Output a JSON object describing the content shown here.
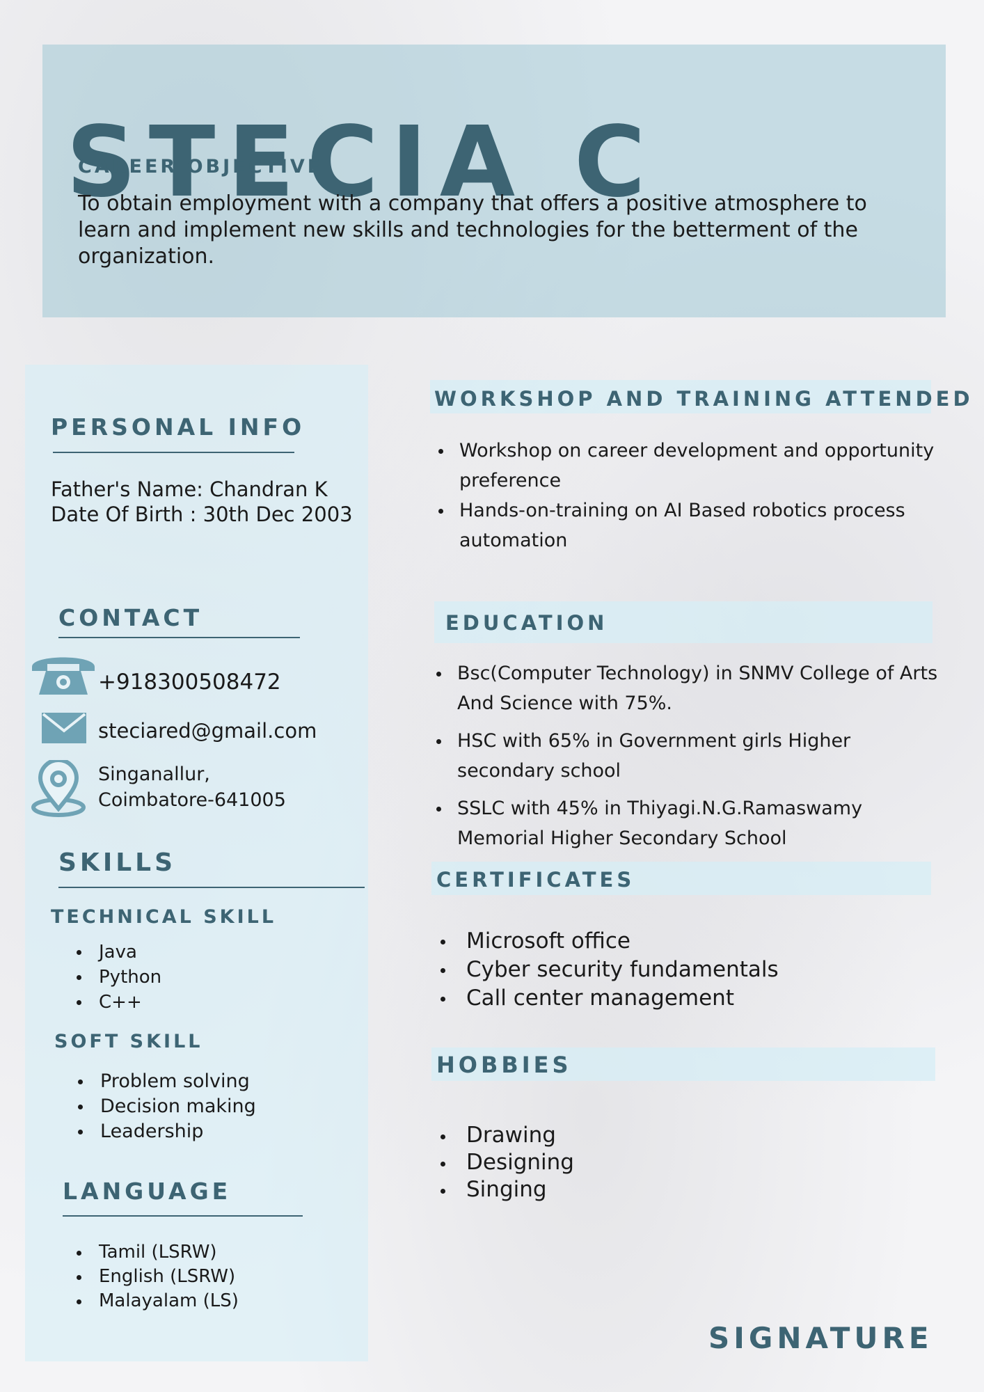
{
  "name": "STECIA C",
  "career_objective": {
    "heading": "CAREER OBJECTIVE",
    "lines": [
      "To obtain employment with a company that offers a positive atmosphere to",
      "learn and implement new skills and technologies for the betterment of the",
      "organization."
    ]
  },
  "personal_info": {
    "heading": "PERSONAL INFO",
    "fathers_name": "Father's Name: Chandran K",
    "dob": "Date Of Birth : 30th Dec 2003"
  },
  "contact": {
    "heading": "CONTACT",
    "phone": "+918300508472",
    "email": "steciared@gmail.com",
    "address_line1": "Singanallur,",
    "address_line2": "Coimbatore-641005",
    "icons": [
      "phone-icon",
      "email-icon",
      "location-pin-icon"
    ]
  },
  "skills": {
    "heading": "SKILLS",
    "technical_heading": "TECHNICAL SKILL",
    "technical": [
      "Java",
      "Python",
      "C++"
    ],
    "soft_heading": "SOFT SKILL",
    "soft": [
      "Problem solving",
      "Decision making",
      "Leadership"
    ]
  },
  "language": {
    "heading": "LANGUAGE",
    "items": [
      "Tamil  (LSRW)",
      "English (LSRW)",
      "Malayalam (LS)"
    ]
  },
  "workshop": {
    "heading": "WORKSHOP AND TRAINING ATTENDED",
    "items": [
      "Workshop on career development and opportunity preference",
      "Hands-on-training on AI Based robotics process automation"
    ]
  },
  "education": {
    "heading": "EDUCATION",
    "items": [
      "Bsc(Computer Technology) in SNMV College of Arts And Science with 75%.",
      "HSC with 65% in Government girls Higher secondary school",
      "SSLC with 45% in Thiyagi.N.G.Ramaswamy Memorial Higher Secondary School"
    ]
  },
  "certificates": {
    "heading": "CERTIFICATES",
    "items": [
      "Microsoft office",
      "Cyber security fundamentals",
      "Call center management"
    ]
  },
  "hobbies": {
    "heading": "HOBBIES",
    "items": [
      "Drawing",
      "Designing",
      "Singing"
    ]
  },
  "signature": "SIGNATURE",
  "colors": {
    "accent": "#3d6473",
    "header_band": "#a0c9d6",
    "panel": "#d6eef6",
    "icon": "#6fa3b5"
  }
}
